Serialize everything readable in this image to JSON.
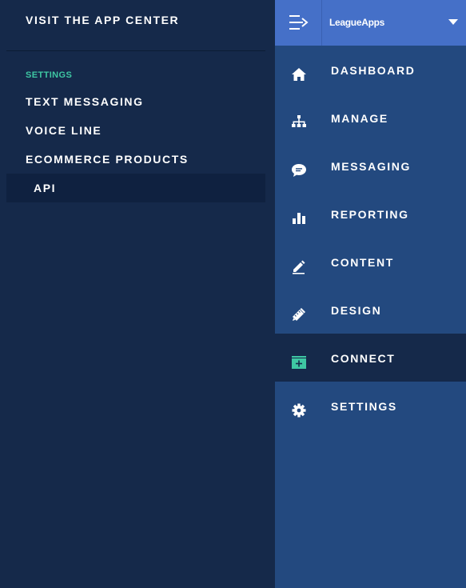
{
  "submenu": {
    "visit_link": "VISIT THE APP CENTER",
    "section_heading": "SETTINGS",
    "section_heading_color": "#3ec7a3",
    "items": [
      {
        "label": "TEXT MESSAGING",
        "active": false
      },
      {
        "label": "VOICE LINE",
        "active": false
      },
      {
        "label": "ECOMMERCE PRODUCTS",
        "active": false
      },
      {
        "label": "API",
        "active": true
      }
    ]
  },
  "header": {
    "toggle_icon": "collapse-menu-icon",
    "org_name": "LeagueApps",
    "dropdown_icon": "chevron-down-icon",
    "accent_color": "#4570c8"
  },
  "nav": {
    "items": [
      {
        "label": "DASHBOARD",
        "icon": "home-icon",
        "active": false
      },
      {
        "label": "MANAGE",
        "icon": "org-chart-icon",
        "active": false
      },
      {
        "label": "MESSAGING",
        "icon": "chat-bubble-icon",
        "active": false
      },
      {
        "label": "REPORTING",
        "icon": "bar-chart-icon",
        "active": false
      },
      {
        "label": "CONTENT",
        "icon": "pencil-icon",
        "active": false
      },
      {
        "label": "DESIGN",
        "icon": "ruler-pencil-icon",
        "active": false
      },
      {
        "label": "CONNECT",
        "icon": "add-box-icon",
        "active": true,
        "icon_color": "#3ec7a3"
      },
      {
        "label": "SETTINGS",
        "icon": "gear-icon",
        "active": false
      }
    ]
  }
}
